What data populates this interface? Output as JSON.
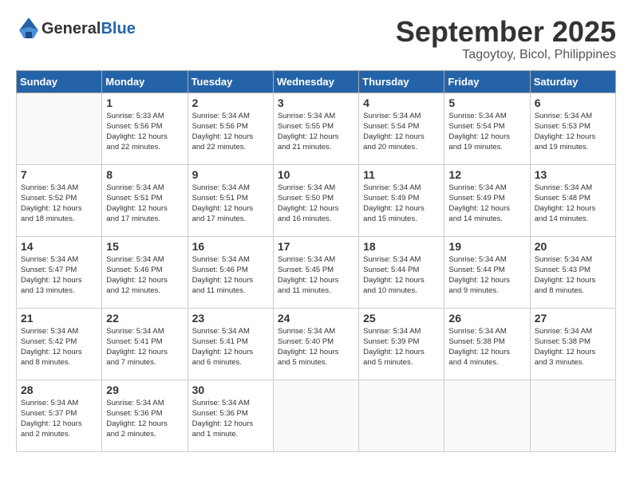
{
  "logo": {
    "general": "General",
    "blue": "Blue"
  },
  "header": {
    "month": "September 2025",
    "location": "Tagoytoy, Bicol, Philippines"
  },
  "weekdays": [
    "Sunday",
    "Monday",
    "Tuesday",
    "Wednesday",
    "Thursday",
    "Friday",
    "Saturday"
  ],
  "weeks": [
    [
      {
        "day": "",
        "info": ""
      },
      {
        "day": "1",
        "info": "Sunrise: 5:33 AM\nSunset: 5:56 PM\nDaylight: 12 hours\nand 22 minutes."
      },
      {
        "day": "2",
        "info": "Sunrise: 5:34 AM\nSunset: 5:56 PM\nDaylight: 12 hours\nand 22 minutes."
      },
      {
        "day": "3",
        "info": "Sunrise: 5:34 AM\nSunset: 5:55 PM\nDaylight: 12 hours\nand 21 minutes."
      },
      {
        "day": "4",
        "info": "Sunrise: 5:34 AM\nSunset: 5:54 PM\nDaylight: 12 hours\nand 20 minutes."
      },
      {
        "day": "5",
        "info": "Sunrise: 5:34 AM\nSunset: 5:54 PM\nDaylight: 12 hours\nand 19 minutes."
      },
      {
        "day": "6",
        "info": "Sunrise: 5:34 AM\nSunset: 5:53 PM\nDaylight: 12 hours\nand 19 minutes."
      }
    ],
    [
      {
        "day": "7",
        "info": "Sunrise: 5:34 AM\nSunset: 5:52 PM\nDaylight: 12 hours\nand 18 minutes."
      },
      {
        "day": "8",
        "info": "Sunrise: 5:34 AM\nSunset: 5:51 PM\nDaylight: 12 hours\nand 17 minutes."
      },
      {
        "day": "9",
        "info": "Sunrise: 5:34 AM\nSunset: 5:51 PM\nDaylight: 12 hours\nand 17 minutes."
      },
      {
        "day": "10",
        "info": "Sunrise: 5:34 AM\nSunset: 5:50 PM\nDaylight: 12 hours\nand 16 minutes."
      },
      {
        "day": "11",
        "info": "Sunrise: 5:34 AM\nSunset: 5:49 PM\nDaylight: 12 hours\nand 15 minutes."
      },
      {
        "day": "12",
        "info": "Sunrise: 5:34 AM\nSunset: 5:49 PM\nDaylight: 12 hours\nand 14 minutes."
      },
      {
        "day": "13",
        "info": "Sunrise: 5:34 AM\nSunset: 5:48 PM\nDaylight: 12 hours\nand 14 minutes."
      }
    ],
    [
      {
        "day": "14",
        "info": "Sunrise: 5:34 AM\nSunset: 5:47 PM\nDaylight: 12 hours\nand 13 minutes."
      },
      {
        "day": "15",
        "info": "Sunrise: 5:34 AM\nSunset: 5:46 PM\nDaylight: 12 hours\nand 12 minutes."
      },
      {
        "day": "16",
        "info": "Sunrise: 5:34 AM\nSunset: 5:46 PM\nDaylight: 12 hours\nand 11 minutes."
      },
      {
        "day": "17",
        "info": "Sunrise: 5:34 AM\nSunset: 5:45 PM\nDaylight: 12 hours\nand 11 minutes."
      },
      {
        "day": "18",
        "info": "Sunrise: 5:34 AM\nSunset: 5:44 PM\nDaylight: 12 hours\nand 10 minutes."
      },
      {
        "day": "19",
        "info": "Sunrise: 5:34 AM\nSunset: 5:44 PM\nDaylight: 12 hours\nand 9 minutes."
      },
      {
        "day": "20",
        "info": "Sunrise: 5:34 AM\nSunset: 5:43 PM\nDaylight: 12 hours\nand 8 minutes."
      }
    ],
    [
      {
        "day": "21",
        "info": "Sunrise: 5:34 AM\nSunset: 5:42 PM\nDaylight: 12 hours\nand 8 minutes."
      },
      {
        "day": "22",
        "info": "Sunrise: 5:34 AM\nSunset: 5:41 PM\nDaylight: 12 hours\nand 7 minutes."
      },
      {
        "day": "23",
        "info": "Sunrise: 5:34 AM\nSunset: 5:41 PM\nDaylight: 12 hours\nand 6 minutes."
      },
      {
        "day": "24",
        "info": "Sunrise: 5:34 AM\nSunset: 5:40 PM\nDaylight: 12 hours\nand 5 minutes."
      },
      {
        "day": "25",
        "info": "Sunrise: 5:34 AM\nSunset: 5:39 PM\nDaylight: 12 hours\nand 5 minutes."
      },
      {
        "day": "26",
        "info": "Sunrise: 5:34 AM\nSunset: 5:38 PM\nDaylight: 12 hours\nand 4 minutes."
      },
      {
        "day": "27",
        "info": "Sunrise: 5:34 AM\nSunset: 5:38 PM\nDaylight: 12 hours\nand 3 minutes."
      }
    ],
    [
      {
        "day": "28",
        "info": "Sunrise: 5:34 AM\nSunset: 5:37 PM\nDaylight: 12 hours\nand 2 minutes."
      },
      {
        "day": "29",
        "info": "Sunrise: 5:34 AM\nSunset: 5:36 PM\nDaylight: 12 hours\nand 2 minutes."
      },
      {
        "day": "30",
        "info": "Sunrise: 5:34 AM\nSunset: 5:36 PM\nDaylight: 12 hours\nand 1 minute."
      },
      {
        "day": "",
        "info": ""
      },
      {
        "day": "",
        "info": ""
      },
      {
        "day": "",
        "info": ""
      },
      {
        "day": "",
        "info": ""
      }
    ]
  ]
}
